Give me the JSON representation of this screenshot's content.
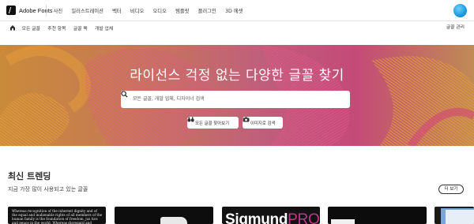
{
  "app": {
    "logo_text": "Adobe Fonts"
  },
  "top_nav": {
    "items": [
      "사진",
      "일러스트레이션",
      "벡터",
      "비디오",
      "오디오",
      "템플릿",
      "플러그인",
      "3D 에셋"
    ]
  },
  "sub_nav": {
    "items": [
      "모든 글꼴",
      "추천 항목",
      "글꼴 팩",
      "개발 업체"
    ],
    "manage_label": "글꼴 관리"
  },
  "hero": {
    "title": "라이선스 걱정 없는 다양한 글꼴 찾기",
    "search_placeholder": "모든 글꼴, 개발 업체, 디자이너 검색",
    "find_fonts_button": "모든 글꼴 찾아보기",
    "image_search_button": "이미지로 검색"
  },
  "trending": {
    "title": "최신 트렌딩",
    "subtitle": "지금 가장 많이 사용되고 있는 글꼴",
    "more_button": "더 보기",
    "cards": [
      {
        "sample_text": "Whereas recognition of the inherent dignity and of the equal and inalienable rights of all members of the human family is the foundation of freedom, jus tice and peace in the world, Whereas disregard and"
      },
      {
        "sample_text": ""
      },
      {
        "sample_text_main": "Sigmund",
        "sample_text_accent": "PRO"
      },
      {
        "sample_text": ""
      },
      {
        "sample_text": ""
      }
    ]
  },
  "colors": {
    "hero_orange": "#c98a3a",
    "hero_pink": "#c44a77",
    "avatar_blue": "#1e9fe0"
  },
  "icons": [
    "home-icon",
    "search-icon",
    "binoculars-icon",
    "camera-icon",
    "adobe-logo-icon",
    "avatar-icon"
  ]
}
